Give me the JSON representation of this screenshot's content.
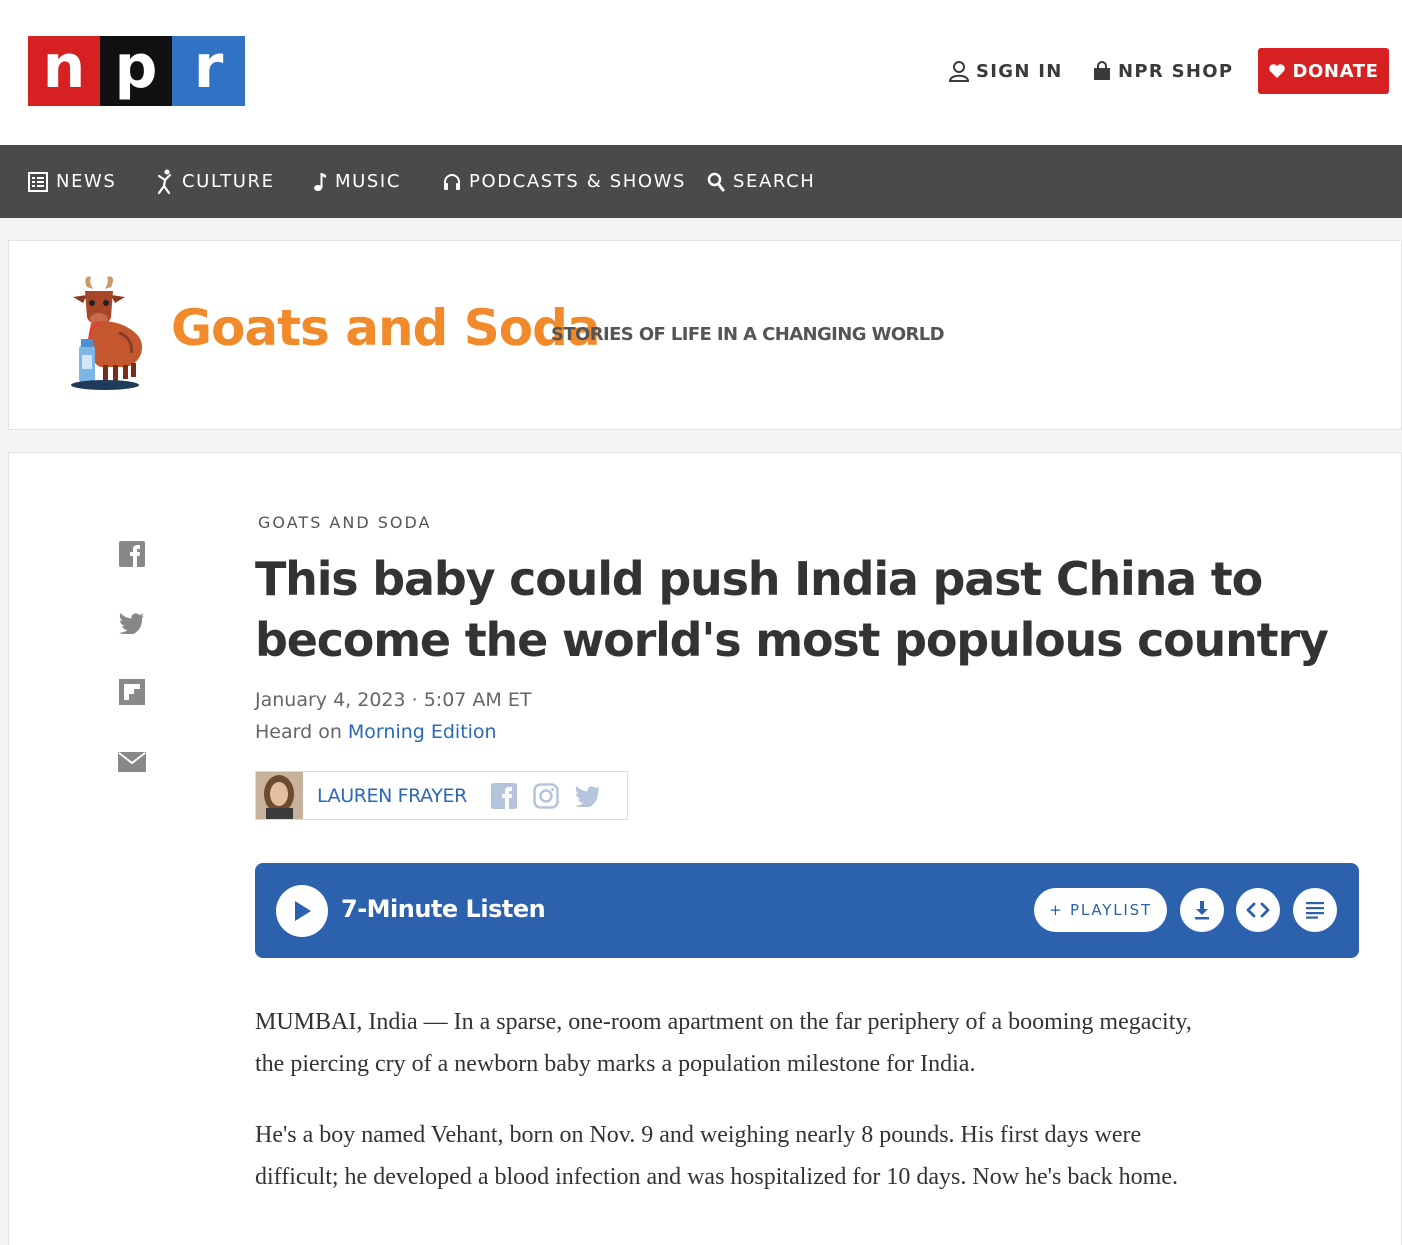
{
  "header": {
    "logo_letters": [
      "n",
      "p",
      "r"
    ],
    "sign_in": "SIGN IN",
    "shop": "NPR SHOP",
    "donate": "DONATE"
  },
  "nav": {
    "items": [
      {
        "label": "NEWS",
        "icon": "news-icon"
      },
      {
        "label": "CULTURE",
        "icon": "culture-icon"
      },
      {
        "label": "MUSIC",
        "icon": "music-note-icon"
      },
      {
        "label": "PODCASTS & SHOWS",
        "icon": "headphones-icon"
      },
      {
        "label": "SEARCH",
        "icon": "search-icon"
      }
    ]
  },
  "banner": {
    "title": "Goats and Soda",
    "tagline": "STORIES OF LIFE IN A CHANGING WORLD"
  },
  "article": {
    "slug": "GOATS AND SODA",
    "headline": "This baby could push India past China to become the world's most populous country",
    "date": "January 4, 2023 · 5:07 AM ET",
    "heard_prefix": "Heard on ",
    "heard_show": "Morning Edition",
    "author": "LAUREN FRAYER",
    "share_icons": [
      "facebook-icon",
      "twitter-icon",
      "flipboard-icon",
      "email-icon"
    ],
    "paragraphs": [
      "MUMBAI, India — In a sparse, one-room apartment on the far periphery of a booming megacity, the piercing cry of a newborn baby marks a population milestone for India.",
      "He's a boy named Vehant, born on Nov. 9 and weighing nearly 8 pounds. His first days were difficult; he developed a blood infection and was hospitalized for 10 days. Now he's back home."
    ]
  },
  "player": {
    "label": "7-Minute Listen",
    "playlist": "+ PLAYLIST"
  },
  "colors": {
    "npr_red": "#d62021",
    "npr_blue": "#3072c4",
    "nav_bg": "#4a4a4a",
    "brand_orange": "#f08a2b",
    "player_blue": "#2c62ad",
    "link_blue": "#2b68b8"
  }
}
